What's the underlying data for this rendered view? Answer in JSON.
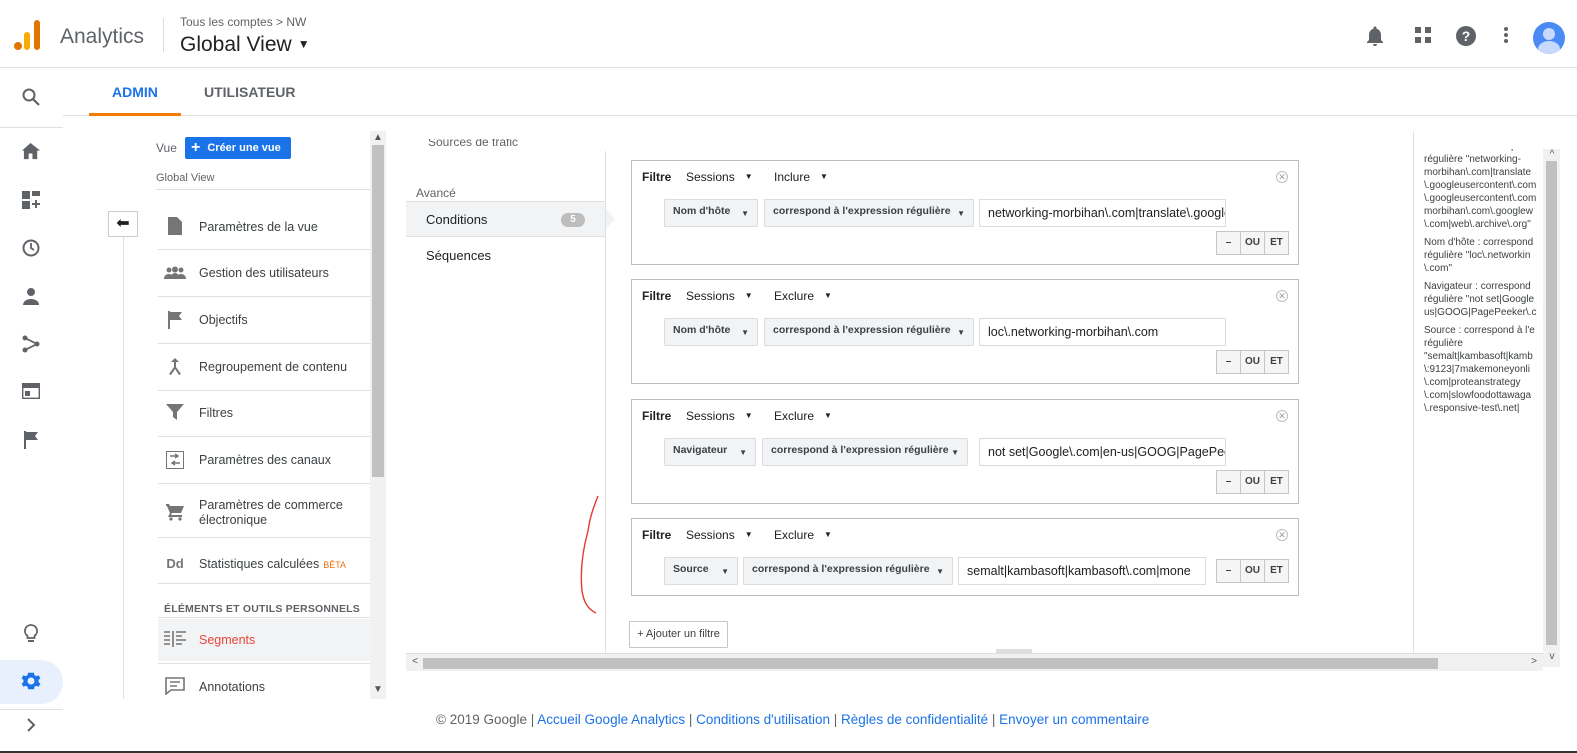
{
  "app": {
    "name": "Analytics"
  },
  "header": {
    "breadcrumb": "Tous les comptes > NW",
    "view_title": "Global View"
  },
  "tabs": [
    {
      "label": "ADMIN",
      "active": true
    },
    {
      "label": "UTILISATEUR",
      "active": false
    }
  ],
  "admin": {
    "vue_label": "Vue",
    "create_button": "Créer une vue",
    "current_view": "Global View",
    "menu": [
      {
        "label": "Paramètres de la vue",
        "icon": "document-icon"
      },
      {
        "label": "Gestion des utilisateurs",
        "icon": "users-icon"
      },
      {
        "label": "Objectifs",
        "icon": "flag-icon"
      },
      {
        "label": "Regroupement de contenu",
        "icon": "grouping-icon"
      },
      {
        "label": "Filtres",
        "icon": "filter-icon"
      },
      {
        "label": "Paramètres des canaux",
        "icon": "channels-icon"
      },
      {
        "label": "Paramètres de commerce électronique",
        "icon": "cart-icon"
      },
      {
        "label": "Statistiques calculées",
        "badge": "BÊTA",
        "icon": "dd-icon"
      }
    ],
    "section_title": "ÉLÉMENTS ET OUTILS PERSONNELS",
    "tools": [
      {
        "label": "Segments",
        "icon": "segments-icon",
        "active": true
      },
      {
        "label": "Annotations",
        "icon": "annotation-icon"
      }
    ]
  },
  "segment_editor": {
    "truncated_item": "Sources de trafic",
    "group_label": "Avancé",
    "conditions_label": "Conditions",
    "conditions_count": "5",
    "sequences_label": "Séquences",
    "filters": [
      {
        "label": "Filtre",
        "scope": "Sessions",
        "mode": "Inclure",
        "dimension": "Nom d'hôte",
        "operator": "correspond à l'expression régulière",
        "value": "networking-morbihan\\.com|translate\\.googleusercontent\\.com"
      },
      {
        "label": "Filtre",
        "scope": "Sessions",
        "mode": "Exclure",
        "dimension": "Nom d'hôte",
        "operator": "correspond à l'expression régulière",
        "value": "loc\\.networking-morbihan\\.com"
      },
      {
        "label": "Filtre",
        "scope": "Sessions",
        "mode": "Exclure",
        "dimension": "Navigateur",
        "operator": "correspond à l'expression régulière",
        "value": "not set|Google\\.com|en-us|GOOG|PagePeeker"
      },
      {
        "label": "Filtre",
        "scope": "Sessions",
        "mode": "Exclure",
        "dimension": "Source",
        "operator": "correspond à l'expression régulière",
        "value": "semalt|kambasoft|kambasoft\\.com|mone"
      }
    ],
    "buttons": {
      "minus": "–",
      "or": "OU",
      "and": "ET"
    },
    "add_filter": "+ Ajouter un filtre",
    "summary": [
      "Nom d'hôte : correspond\nrégulière \"networking-\nmorbihan\\.com|translate\n\\.googleusercontent\\.com\n\\.googleusercontent\\.com\nmorbihan\\.com\\.googlew\n\\.com|web\\.archive\\.org\"",
      "Nom d'hôte : correspond\nrégulière \"loc\\.networkin\n\\.com\"",
      "Navigateur : correspond\nrégulière \"not set|Google\nus|GOOG|PagePeeker\\.c",
      "Source : correspond à l'e\nrégulière\n\"semalt|kambasoft|kamb\n\\:9123|7makemoneyonli\n\\.com|proteanstrategy\n\\.com|slowfoodottawaga\n\\.responsive-test\\.net|"
    ]
  },
  "footer": {
    "copyright": "© 2019 Google",
    "links": [
      "Accueil Google Analytics",
      "Conditions d'utilisation",
      "Règles de confidentialité",
      "Envoyer un commentaire"
    ]
  },
  "colors": {
    "accent": "#1a73e8",
    "tab_underline": "#f57c00",
    "brand_orange": "#f9ab00",
    "annotation_red": "#e53935"
  }
}
